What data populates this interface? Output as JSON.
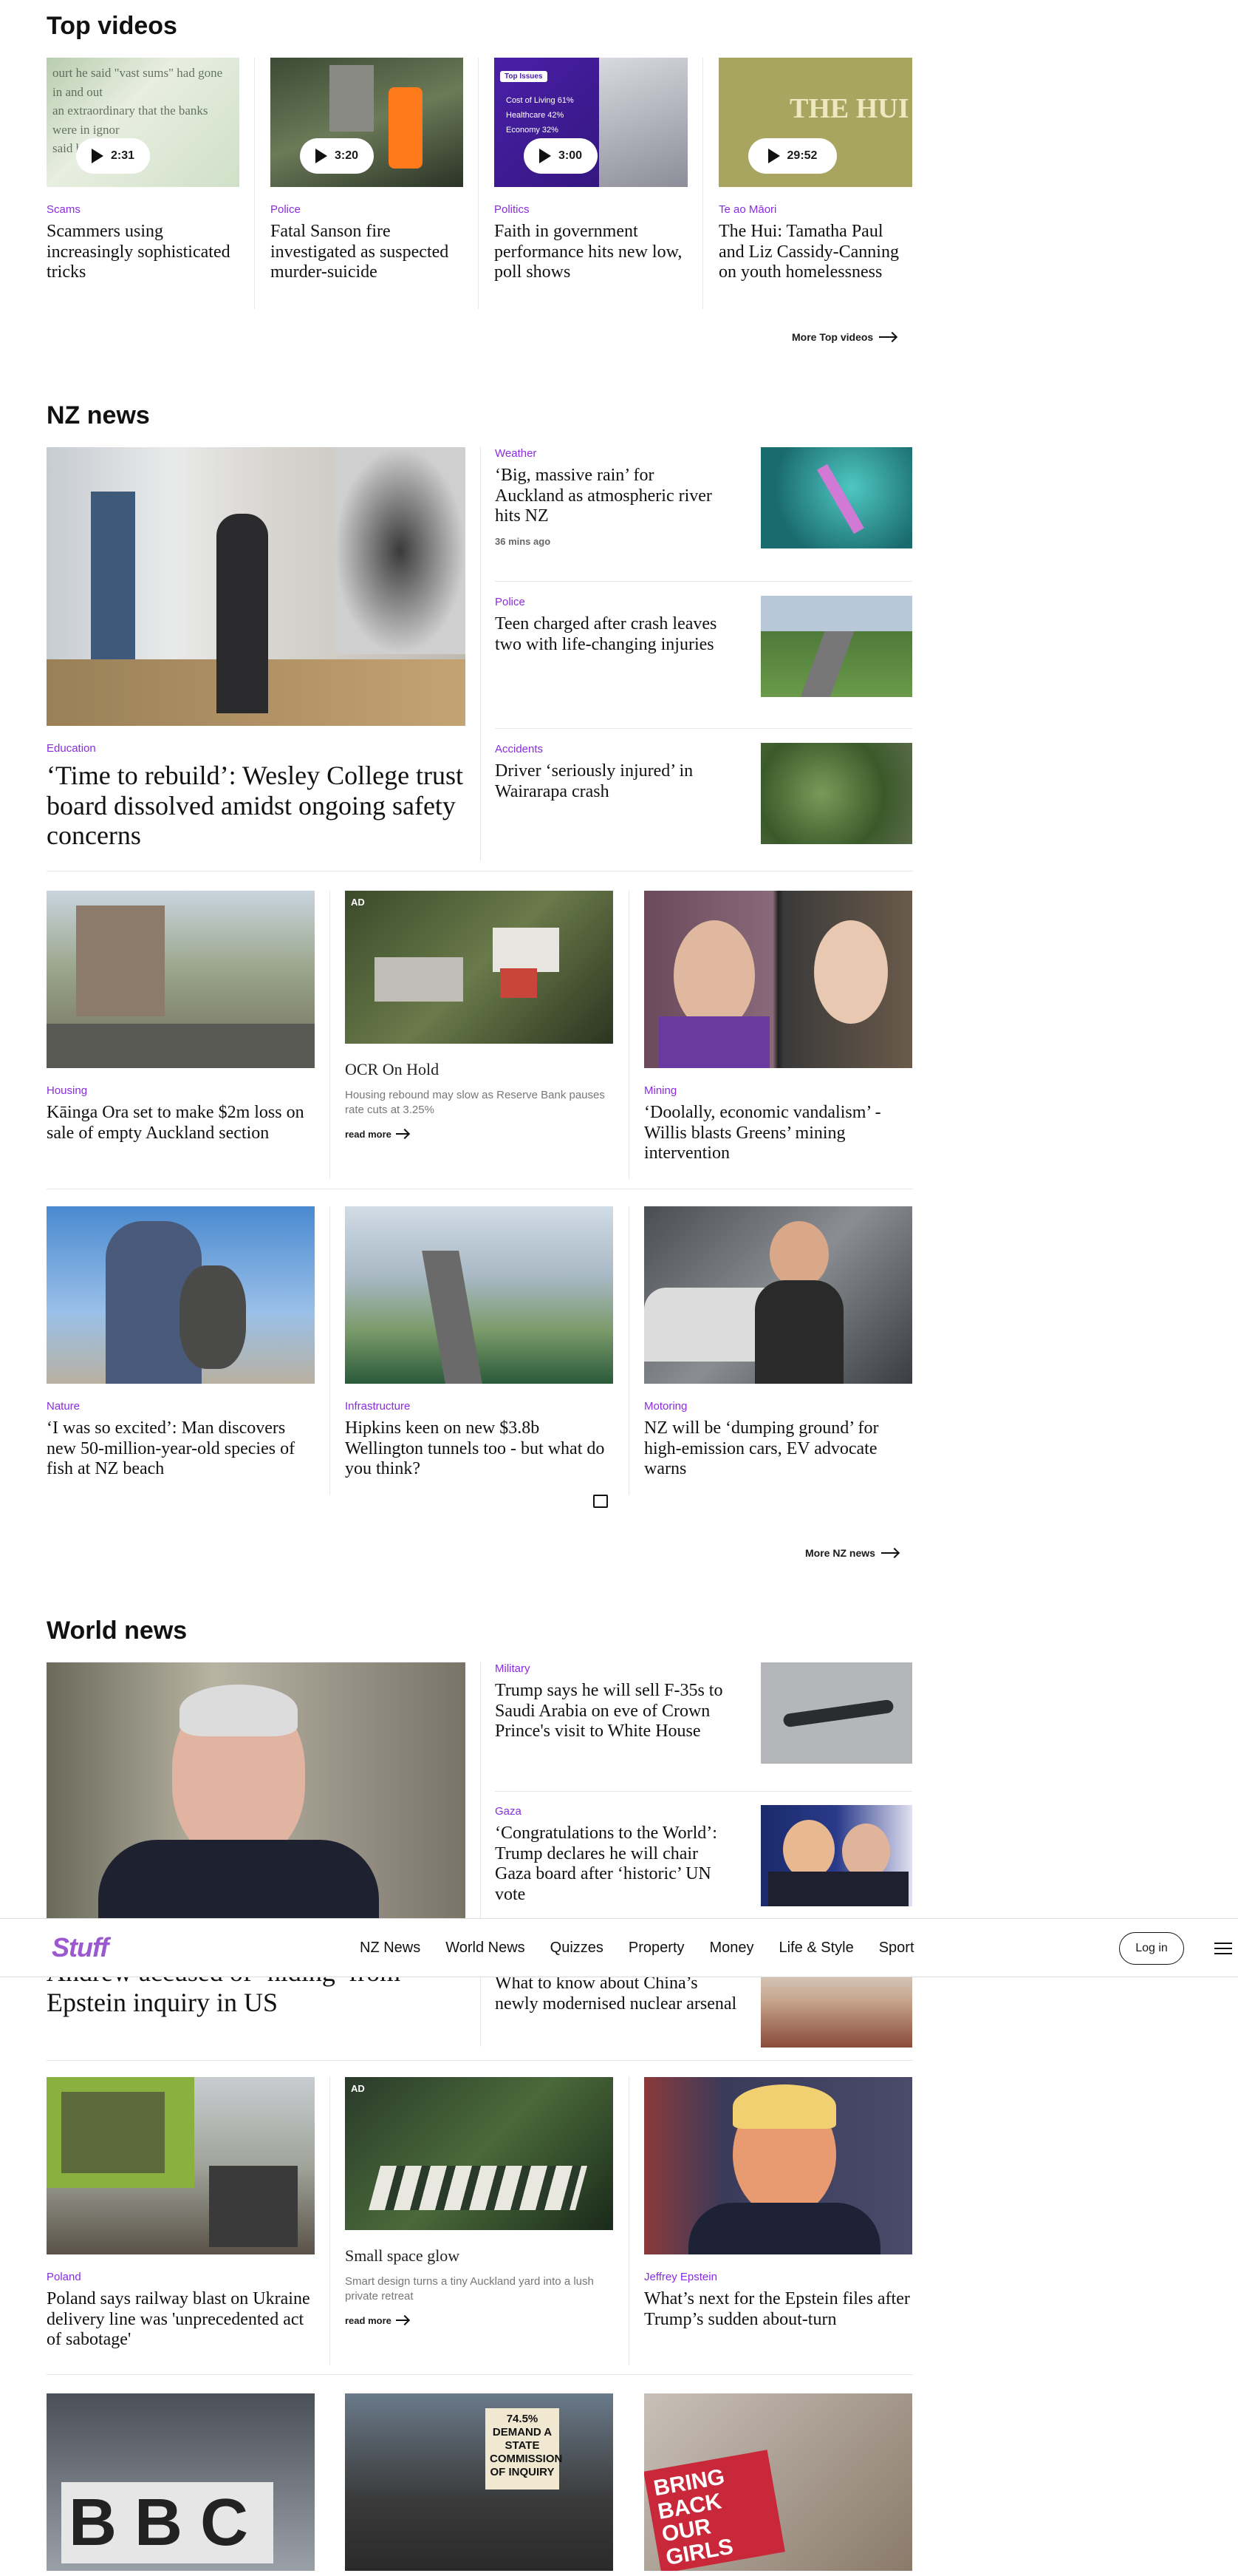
{
  "top_videos": {
    "title": "Top videos",
    "more": "More Top videos",
    "items": [
      {
        "category": "Scams",
        "headline": "Scammers using increasingly sophisticated tricks",
        "duration": "2:31"
      },
      {
        "category": "Police",
        "headline": "Fatal Sanson fire investigated as suspected murder-suicide",
        "duration": "3:20"
      },
      {
        "category": "Politics",
        "headline": "Faith in government performance hits new low, poll shows",
        "duration": "3:00",
        "overlay": {
          "tag": "Top Issues",
          "rows": [
            "Cost of Living 61%",
            "Healthcare 42%",
            "Economy 32%"
          ]
        }
      },
      {
        "category": "Te ao Māori",
        "headline": "The Hui: Tamatha Paul and Liz Cassidy-Canning on youth homelessness",
        "duration": "29:52",
        "overlay": {
          "logo": "THE HUI"
        }
      }
    ]
  },
  "nz_news": {
    "title": "NZ news",
    "more": "More NZ news",
    "lead": {
      "category": "Education",
      "headline": "‘Time to rebuild’: Wesley College trust board dissolved amidst ongoing safety concerns"
    },
    "side": [
      {
        "category": "Weather",
        "headline": "‘Big, massive rain’ for Auckland as atmospheric river hits NZ",
        "time": "36 mins ago"
      },
      {
        "category": "Police",
        "headline": "Teen charged after crash leaves two with life-changing injuries"
      },
      {
        "category": "Accidents",
        "headline": "Driver ‘seriously injured’ in Wairarapa crash"
      }
    ],
    "row1": [
      {
        "category": "Housing",
        "headline": "Kāinga Ora set to make $2m loss on sale of empty Auckland section"
      },
      {
        "ad": "AD",
        "headline": "OCR On Hold",
        "sub": "Housing rebound may slow as Reserve Bank pauses rate cuts at 3.25%",
        "read_more": "read more"
      },
      {
        "category": "Mining",
        "headline": "‘Doolally, economic vandalism’ - Willis blasts Greens’ mining intervention"
      }
    ],
    "row2": [
      {
        "category": "Nature",
        "headline": "‘I was so excited’: Man discovers new 50-million-year-old species of fish at NZ beach"
      },
      {
        "category": "Infrastructure",
        "headline": "Hipkins keen on new $3.8b Wellington tunnels too - but what do you think?"
      },
      {
        "category": "Motoring",
        "headline": "NZ will be ‘dumping ground’ for high-emission cars, EV advocate warns"
      }
    ]
  },
  "world_news": {
    "title": "World news",
    "lead": {
      "headline": "Andrew accused of ‘hiding’ from Epstein inquiry in US"
    },
    "side": [
      {
        "category": "Military",
        "headline": "Trump says he will sell F-35s to Saudi Arabia on eve of Crown Prince's visit to White House"
      },
      {
        "category": "Gaza",
        "headline": "‘Congratulations to the World’: Trump declares he will chair Gaza board after ‘historic’ UN vote"
      },
      {
        "headline": "What to know about China’s newly modernised nuclear arsenal"
      }
    ],
    "row1": [
      {
        "category": "Poland",
        "headline": "Poland says railway blast on Ukraine delivery line was 'unprecedented act of sabotage'"
      },
      {
        "ad": "AD",
        "headline": "Small space glow",
        "sub": "Smart design turns a tiny Auckland yard into a lush private retreat",
        "read_more": "read more"
      },
      {
        "category": "Jeffrey Epstein",
        "headline": "What’s next for the Epstein files after Trump’s sudden about-turn"
      }
    ],
    "row2_images": [
      {
        "text": "BBC"
      },
      {
        "sign": "74.5% DEMAND A STATE COMMISSION OF INQUIRY"
      },
      {
        "sign": "BRING BACK OUR GIRLS"
      }
    ]
  },
  "nav": {
    "logo": "Stuff",
    "links": [
      "NZ News",
      "World News",
      "Quizzes",
      "Property",
      "Money",
      "Life & Style",
      "Sport"
    ],
    "login": "Log in"
  },
  "colors": {
    "accent": "#8a2be2",
    "logo": "#9b59d0"
  }
}
